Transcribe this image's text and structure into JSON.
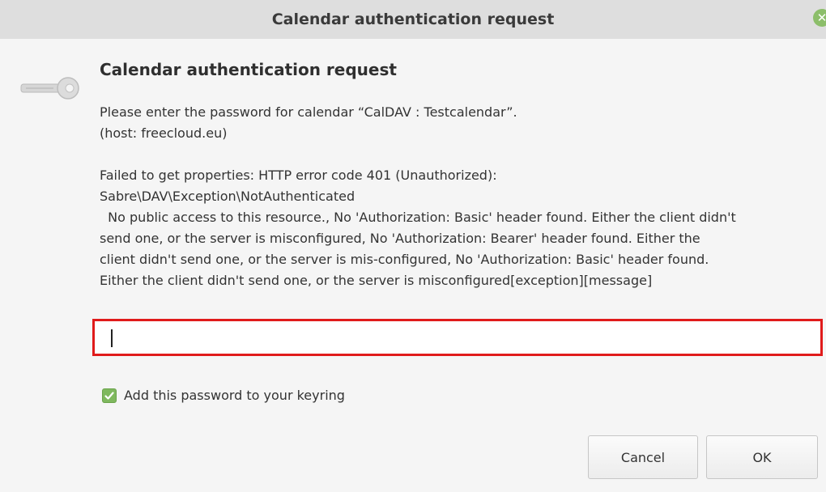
{
  "window": {
    "title": "Calendar authentication request"
  },
  "dialog": {
    "heading": "Calendar authentication request",
    "message_lines": [
      "Please enter the password for calendar “CalDAV : Testcalendar”.",
      "(host: freecloud.eu)"
    ],
    "error_lines": [
      "Failed to get properties: HTTP error code 401 (Unauthorized):",
      "Sabre\\DAV\\Exception\\NotAuthenticated",
      "  No public access to this resource., No 'Authorization: Basic' header found. Either the client didn't",
      "send one, or the server is misconfigured, No 'Authorization: Bearer' header found. Either the",
      "client didn't send one, or the server is mis-configured, No 'Authorization: Basic' header found.",
      "Either the client didn't send one, or the server is misconfigured[exception][message]"
    ],
    "password": {
      "value": ""
    },
    "keyring": {
      "label": "Add this password to your keyring",
      "checked": true
    },
    "buttons": {
      "cancel": "Cancel",
      "ok": "OK"
    }
  },
  "icons": {
    "close": "close-icon",
    "key": "key-icon",
    "check": "checkmark-icon"
  },
  "colors": {
    "titlebar": "#dedede",
    "accent_green": "#8cbe6a",
    "input_error_border": "#e01b1b"
  }
}
